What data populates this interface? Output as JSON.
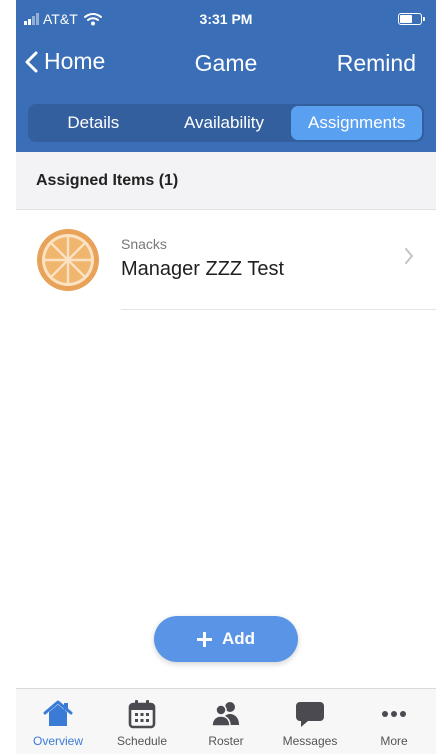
{
  "status_bar": {
    "carrier": "AT&T",
    "time": "3:31 PM"
  },
  "nav": {
    "back_label": "Home",
    "title": "Game",
    "action_label": "Remind"
  },
  "segments": [
    {
      "label": "Details",
      "active": false
    },
    {
      "label": "Availability",
      "active": false
    },
    {
      "label": "Assignments",
      "active": true
    }
  ],
  "section": {
    "title": "Assigned Items (1)"
  },
  "items": [
    {
      "category": "Snacks",
      "title": "Manager ZZZ Test",
      "icon": "orange-slice-icon"
    }
  ],
  "add_button": {
    "label": "Add"
  },
  "tabs": [
    {
      "label": "Overview",
      "icon": "home-icon",
      "active": true
    },
    {
      "label": "Schedule",
      "icon": "calendar-icon",
      "active": false
    },
    {
      "label": "Roster",
      "icon": "roster-icon",
      "active": false
    },
    {
      "label": "Messages",
      "icon": "messages-icon",
      "active": false
    },
    {
      "label": "More",
      "icon": "more-icon",
      "active": false
    }
  ],
  "colors": {
    "header": "#3a6fb7",
    "active_segment": "#5aa0f0",
    "accent": "#3a7bd5",
    "add_button": "#5a94e6",
    "avatar": "#e8a25a"
  }
}
